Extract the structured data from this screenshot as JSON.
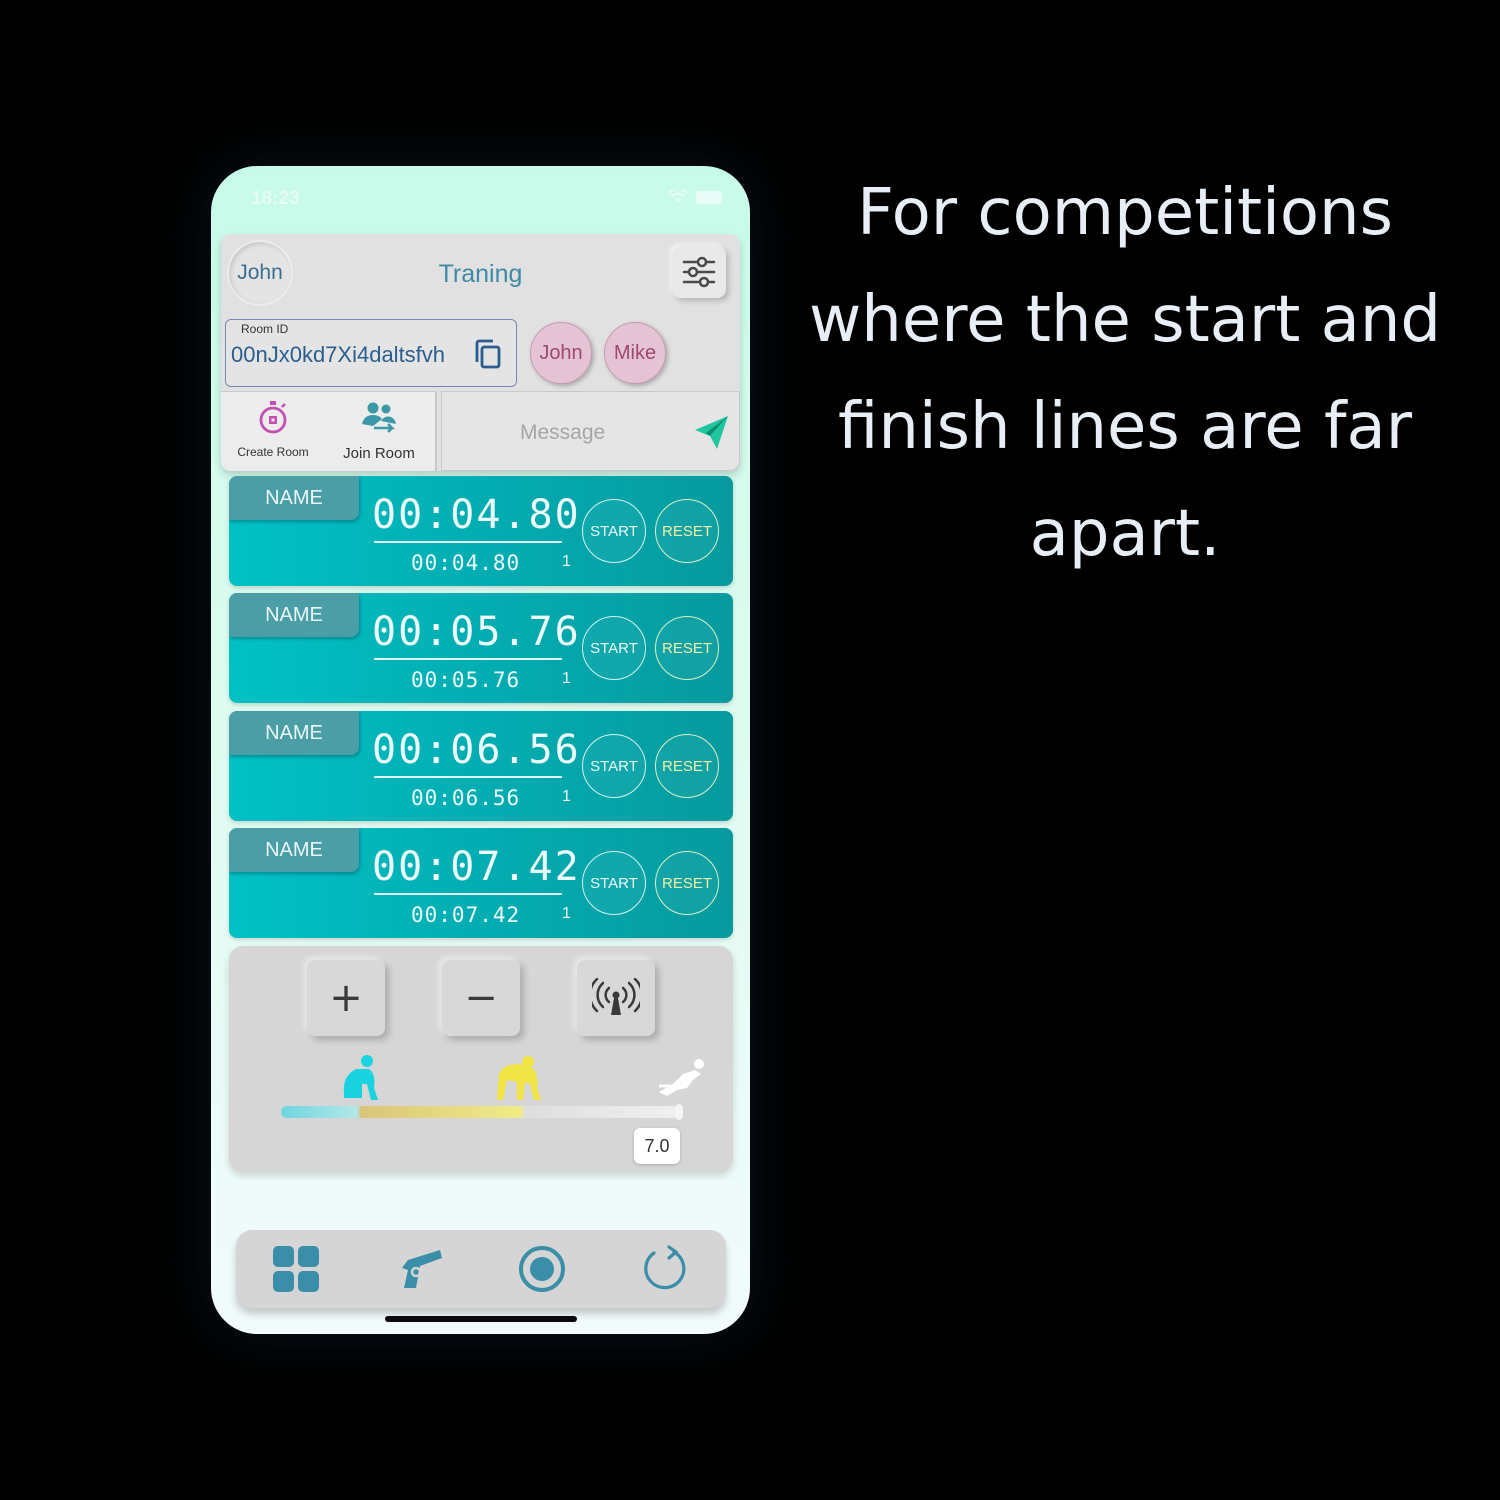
{
  "status_bar": {
    "time": "18:23"
  },
  "header": {
    "user_name": "John",
    "title": "Traning",
    "room_id_label": "Room ID",
    "room_id_value": "00nJx0kd7Xi4daltsfvh",
    "participants": [
      "John",
      "Mike"
    ]
  },
  "actions": {
    "create_room": "Create Room",
    "join_room": "Join Room",
    "message_placeholder": "Message"
  },
  "timers": [
    {
      "name": "NAME",
      "main_time": "00:04.80",
      "split_time": "00:04.80",
      "lap": "1",
      "start": "START",
      "reset": "RESET"
    },
    {
      "name": "NAME",
      "main_time": "00:05.76",
      "split_time": "00:05.76",
      "lap": "1",
      "start": "START",
      "reset": "RESET"
    },
    {
      "name": "NAME",
      "main_time": "00:06.56",
      "split_time": "00:06.56",
      "lap": "1",
      "start": "START",
      "reset": "RESET"
    },
    {
      "name": "NAME",
      "main_time": "00:07.42",
      "split_time": "00:07.42",
      "lap": "1",
      "start": "START",
      "reset": "RESET"
    }
  ],
  "controls": {
    "plus": "+",
    "minus": "−",
    "slider_value": "7.0",
    "slider_value_fraction": 1.0,
    "icons": [
      "plus-icon",
      "minus-icon",
      "broadcast-icon"
    ]
  },
  "tabbar": {
    "icons": [
      "grid-icon",
      "starter-pistol-icon",
      "record-icon",
      "refresh-icon"
    ]
  },
  "colors": {
    "accent": "#3f8aa6",
    "timer_card": "#03adb2",
    "reset_text": "#f1efa6",
    "chip": "#e4c4d4"
  },
  "caption": "For competitions where the start and finish lines are far apart."
}
